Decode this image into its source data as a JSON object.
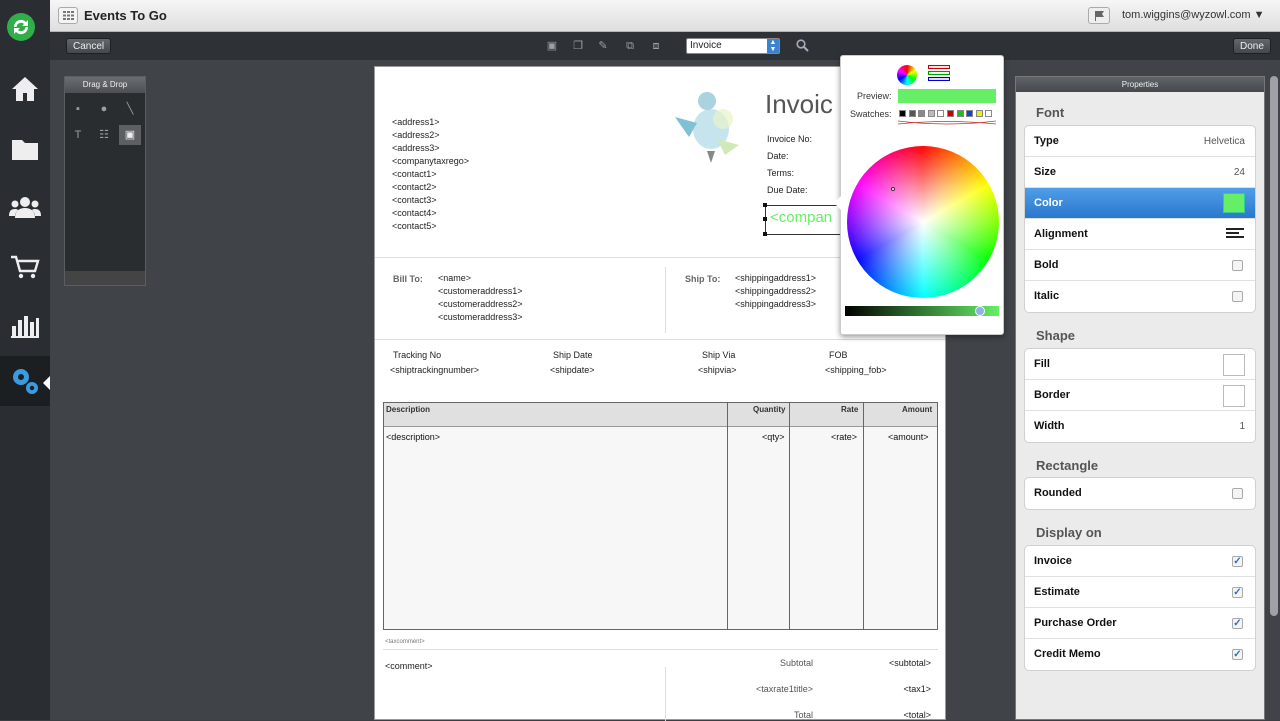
{
  "app": {
    "title": "Events To Go",
    "user": "tom.wiggins@wyzowl.com ▼"
  },
  "toolbar": {
    "cancel": "Cancel",
    "done": "Done",
    "doc_type": "Invoice"
  },
  "palette": {
    "title": "Drag & Drop"
  },
  "document": {
    "title": "Invoic",
    "address_lines": [
      "<address1>",
      "<address2>",
      "<address3>",
      "<companytaxrego>",
      "<contact1>",
      "<contact2>",
      "<contact3>",
      "<contact4>",
      "<contact5>"
    ],
    "meta_labels": [
      "Invoice No:",
      "Date:",
      "Terms:",
      "Due Date:"
    ],
    "company_field": "<compan",
    "bill_to_label": "Bill To:",
    "bill_to": [
      "<name>",
      "<customeraddress1>",
      "<customeraddress2>",
      "<customeraddress3>"
    ],
    "ship_to_label": "Ship To:",
    "ship_to": [
      "<shippingaddress1>",
      "<shippingaddress2>",
      "<shippingaddress3>"
    ],
    "shipping_headers": [
      "Tracking No",
      "Ship Date",
      "Ship Via",
      "FOB"
    ],
    "shipping_values": [
      "<shiptrackingnumber>",
      "<shipdate>",
      "<shipvia>",
      "<shipping_fob>"
    ],
    "table_headers": [
      "Description",
      "Quantity",
      "Rate",
      "Amount"
    ],
    "table_row": [
      "<description>",
      "<qty>",
      "<rate>",
      "<amount>"
    ],
    "tax_comment": "<taxcomment>",
    "comment": "<comment>",
    "totals": [
      {
        "label": "Subtotal",
        "value": "<subtotal>"
      },
      {
        "label": "<taxrate1title>",
        "value": "<tax1>"
      },
      {
        "label": "Total",
        "value": "<total>"
      }
    ]
  },
  "picker": {
    "preview_label": "Preview:",
    "swatches_label": "Swatches:",
    "preview_color": "#66ee66",
    "swatches": [
      "#000000",
      "#555555",
      "#888888",
      "#bbbbbb",
      "#ffffff",
      "#cc0000",
      "#22bb22",
      "#1144cc",
      "#eeee00",
      "#ffffff"
    ]
  },
  "properties": {
    "title": "Properties",
    "font_section": "Font",
    "font_type_label": "Type",
    "font_type_value": "Helvetica",
    "size_label": "Size",
    "size_value": "24",
    "color_label": "Color",
    "color_value": "#66ee66",
    "alignment_label": "Alignment",
    "bold_label": "Bold",
    "bold_checked": false,
    "italic_label": "Italic",
    "italic_checked": false,
    "shape_section": "Shape",
    "fill_label": "Fill",
    "border_label": "Border",
    "width_label": "Width",
    "width_value": "1",
    "rect_section": "Rectangle",
    "rounded_label": "Rounded",
    "rounded_checked": false,
    "display_section": "Display on",
    "display_items": [
      {
        "label": "Invoice",
        "checked": true
      },
      {
        "label": "Estimate",
        "checked": true
      },
      {
        "label": "Purchase Order",
        "checked": true
      },
      {
        "label": "Credit Memo",
        "checked": true
      }
    ]
  }
}
